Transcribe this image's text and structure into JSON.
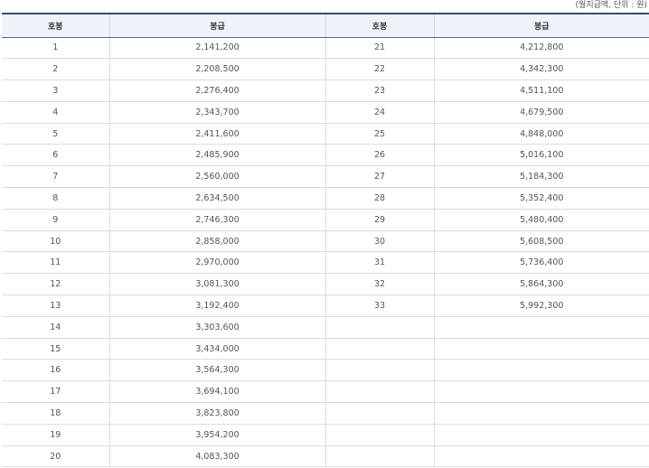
{
  "unit_note": "(월지급액, 단위 : 원)",
  "headers": [
    "호봉",
    "봉급",
    "호봉",
    "봉급"
  ],
  "rows": [
    {
      "left_step": "1",
      "left_pay": "2,141,200",
      "right_step": "21",
      "right_pay": "4,212,800"
    },
    {
      "left_step": "2",
      "left_pay": "2,208,500",
      "right_step": "22",
      "right_pay": "4,342,300"
    },
    {
      "left_step": "3",
      "left_pay": "2,276,400",
      "right_step": "23",
      "right_pay": "4,511,100"
    },
    {
      "left_step": "4",
      "left_pay": "2,343,700",
      "right_step": "24",
      "right_pay": "4,679,500"
    },
    {
      "left_step": "5",
      "left_pay": "2,411,600",
      "right_step": "25",
      "right_pay": "4,848,000"
    },
    {
      "left_step": "6",
      "left_pay": "2,485,900",
      "right_step": "26",
      "right_pay": "5,016,100"
    },
    {
      "left_step": "7",
      "left_pay": "2,560,000",
      "right_step": "27",
      "right_pay": "5,184,300"
    },
    {
      "left_step": "8",
      "left_pay": "2,634,500",
      "right_step": "28",
      "right_pay": "5,352,400"
    },
    {
      "left_step": "9",
      "left_pay": "2,746,300",
      "right_step": "29",
      "right_pay": "5,480,400"
    },
    {
      "left_step": "10",
      "left_pay": "2,858,000",
      "right_step": "30",
      "right_pay": "5,608,500"
    },
    {
      "left_step": "11",
      "left_pay": "2,970,000",
      "right_step": "31",
      "right_pay": "5,736,400"
    },
    {
      "left_step": "12",
      "left_pay": "3,081,300",
      "right_step": "32",
      "right_pay": "5,864,300"
    },
    {
      "left_step": "13",
      "left_pay": "3,192,400",
      "right_step": "33",
      "right_pay": "5,992,300"
    },
    {
      "left_step": "14",
      "left_pay": "3,303,600",
      "right_step": "",
      "right_pay": ""
    },
    {
      "left_step": "15",
      "left_pay": "3,434,000",
      "right_step": "",
      "right_pay": ""
    },
    {
      "left_step": "16",
      "left_pay": "3,564,300",
      "right_step": "",
      "right_pay": ""
    },
    {
      "left_step": "17",
      "left_pay": "3,694,100",
      "right_step": "",
      "right_pay": ""
    },
    {
      "left_step": "18",
      "left_pay": "3,823,800",
      "right_step": "",
      "right_pay": ""
    },
    {
      "left_step": "19",
      "left_pay": "3,954,200",
      "right_step": "",
      "right_pay": ""
    },
    {
      "left_step": "20",
      "left_pay": "4,083,300",
      "right_step": "",
      "right_pay": ""
    }
  ]
}
